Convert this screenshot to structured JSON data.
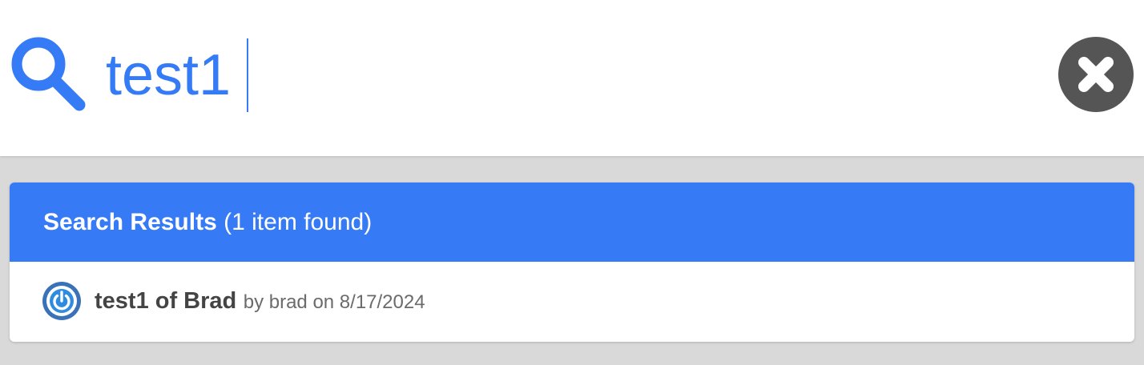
{
  "search": {
    "query": "test1",
    "icon": "search-icon",
    "clear_icon": "close-icon"
  },
  "results": {
    "heading_bold": "Search Results",
    "heading_count": "(1 item found)",
    "items": [
      {
        "title": "test1 of Brad",
        "meta": "by brad on 8/17/2024",
        "avatar_icon": "power-icon"
      }
    ]
  },
  "colors": {
    "accent": "#357bf6",
    "header_bg": "#367bf5",
    "clear_button": "#555555",
    "page_bg": "#d9d9d9"
  }
}
